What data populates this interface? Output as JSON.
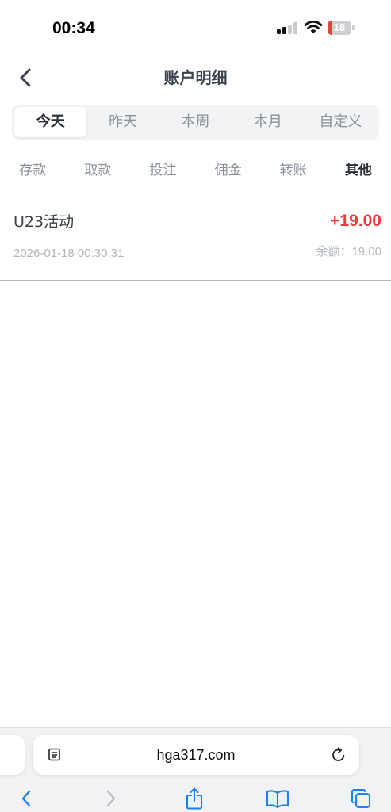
{
  "status_bar": {
    "time": "00:34",
    "battery_level": "18",
    "battery_fraction": 0.18,
    "icons": [
      "signal-icon",
      "wifi-icon",
      "battery-icon"
    ]
  },
  "header": {
    "title": "账户明细",
    "back_icon": "chevron-left-icon"
  },
  "date_tabs": {
    "items": [
      "今天",
      "昨天",
      "本周",
      "本月",
      "自定义"
    ],
    "selected": "今天"
  },
  "category_tabs": {
    "items": [
      "存款",
      "取款",
      "投注",
      "佣金",
      "转账",
      "其他"
    ],
    "selected": "其他"
  },
  "records": [
    {
      "name": "U23活动",
      "amount": "+19.00",
      "time": "2026-01-18 00:30:31",
      "balance_label": "余额：",
      "balance_value": "19.00"
    }
  ],
  "browser": {
    "url": "hga317.com",
    "icons": [
      "reader-icon",
      "reload-icon",
      "back-icon",
      "forward-icon",
      "share-icon",
      "bookmarks-icon",
      "tabs-icon"
    ]
  },
  "colors": {
    "accent_blue": "#1a82f5",
    "amount_red": "#ef3b3b",
    "battery_red": "#e8413a",
    "title_gray": "#3d4450"
  }
}
